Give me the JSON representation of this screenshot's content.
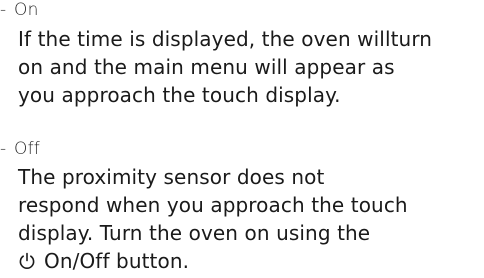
{
  "options": [
    {
      "title": "On",
      "description_lines": [
        "If the time is displayed, the oven willturn",
        "on and the main menu will appear as",
        "you approach the touch display."
      ]
    },
    {
      "title": "Off",
      "description_lines": [
        "The proximity sensor does not",
        "respond when you approach the touch",
        "display. Turn the oven on using the"
      ],
      "button_label": "On/Off button.",
      "button_icon": "power-icon"
    }
  ]
}
